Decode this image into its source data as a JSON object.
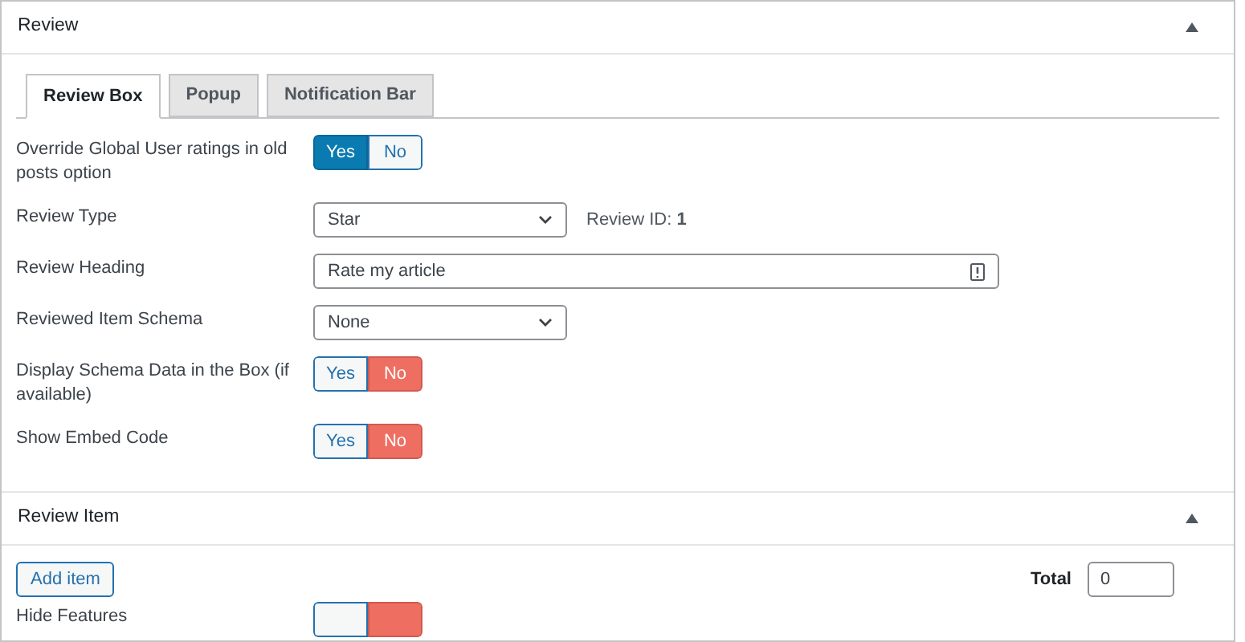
{
  "review_panel": {
    "title": "Review",
    "expanded": true,
    "tabs": [
      {
        "label": "Review Box",
        "selected": true
      },
      {
        "label": "Popup",
        "selected": false
      },
      {
        "label": "Notification Bar",
        "selected": false
      }
    ],
    "fields": [
      {
        "kind": "toggle",
        "label": "Override Global User ratings in old posts option",
        "options": [
          {
            "label": "Yes",
            "selected": true
          },
          {
            "label": "No",
            "selected": false
          }
        ]
      },
      {
        "kind": "select",
        "label": "Review Type",
        "value": "Star",
        "note": "Review ID: **1**"
      },
      {
        "kind": "text",
        "label": "Review Heading",
        "value": "Rate my article"
      },
      {
        "kind": "select",
        "label": "Reviewed Item Schema",
        "value": "None"
      },
      {
        "kind": "toggle",
        "label": "Display Schema Data in the Box (if available)",
        "options": [
          {
            "label": "Yes",
            "selected": false
          },
          {
            "label": "No",
            "selected": true
          }
        ]
      },
      {
        "kind": "toggle",
        "label": "Show Embed Code",
        "options": [
          {
            "label": "Yes",
            "selected": false
          },
          {
            "label": "No",
            "selected": true
          }
        ]
      }
    ]
  },
  "review_item_panel": {
    "title": "Review Item",
    "expanded": true,
    "add_button": "Add item",
    "total_label": "Total",
    "total_value": "0",
    "fields": [
      {
        "kind": "toggle",
        "label": "Hide Features",
        "options": [
          {
            "selected": false
          },
          {
            "selected": true
          }
        ]
      }
    ]
  }
}
